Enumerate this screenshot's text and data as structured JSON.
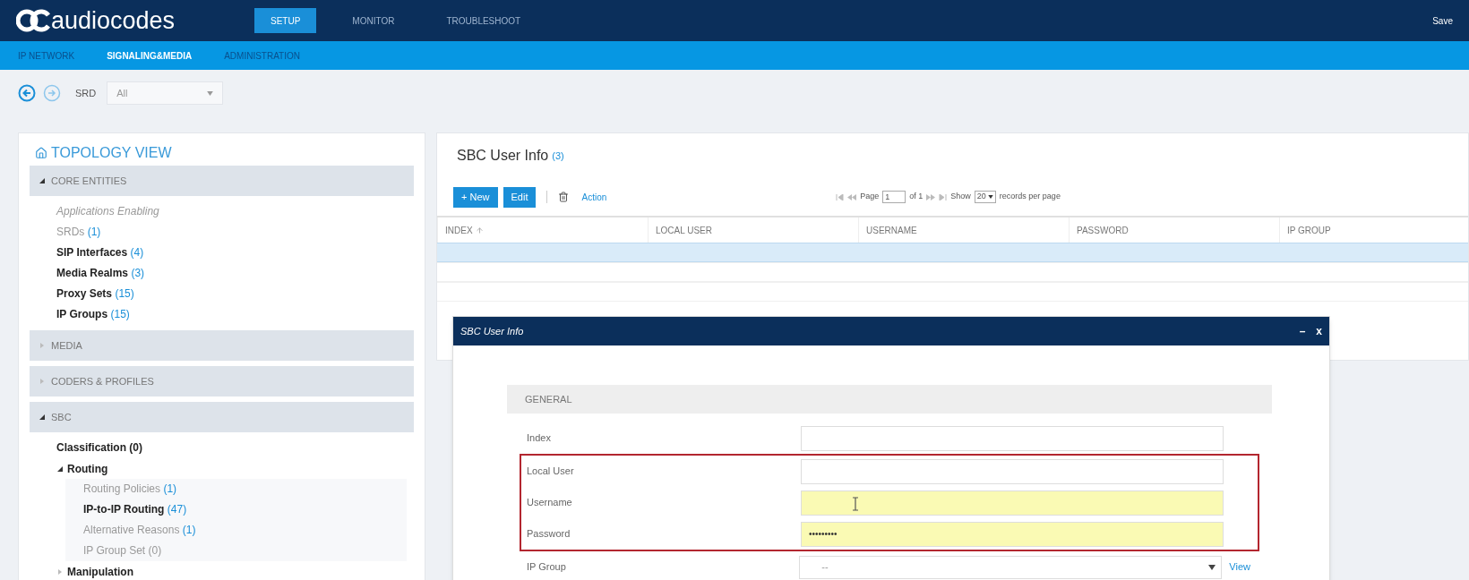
{
  "header": {
    "logo": "audiocodes",
    "tabs": [
      {
        "label": "SETUP",
        "selected": true
      },
      {
        "label": "MONITOR",
        "selected": false
      },
      {
        "label": "TROUBLESHOOT",
        "selected": false
      }
    ],
    "save": "Save"
  },
  "subnav": [
    {
      "label": "IP NETWORK",
      "selected": false
    },
    {
      "label": "SIGNALING&MEDIA",
      "selected": true
    },
    {
      "label": "ADMINISTRATION",
      "selected": false
    }
  ],
  "toolbar": {
    "srd_label": "SRD",
    "srd_value": "All"
  },
  "sidebar": {
    "title": "TOPOLOGY VIEW",
    "sections": [
      {
        "label": "CORE ENTITIES",
        "expanded": true,
        "items": [
          {
            "kind": "note",
            "label": "Applications Enabling",
            "dimmed": true
          },
          {
            "kind": "entry",
            "label": "SRDs",
            "count": "(1)",
            "dimmed": true
          },
          {
            "kind": "entry",
            "label": "SIP Interfaces",
            "count": "(4)",
            "dimmed": false
          },
          {
            "kind": "entry",
            "label": "Media Realms",
            "count": "(3)",
            "dimmed": false
          },
          {
            "kind": "entry",
            "label": "Proxy Sets",
            "count": "(15)",
            "dimmed": false
          },
          {
            "kind": "entry",
            "label": "IP Groups",
            "count": "(15)",
            "dimmed": false
          }
        ]
      },
      {
        "label": "MEDIA",
        "expanded": false
      },
      {
        "label": "CODERS & PROFILES",
        "expanded": false
      },
      {
        "label": "SBC",
        "expanded": true,
        "items": [
          {
            "kind": "entry",
            "label": "Classification (0)",
            "dimmed": false
          },
          {
            "kind": "folder",
            "label": "Routing",
            "expanded": true,
            "children": [
              {
                "kind": "entry",
                "label": "Routing Policies",
                "count": "(1)",
                "dimmed": true
              },
              {
                "kind": "entry",
                "label": "IP-to-IP Routing",
                "count": "(47)",
                "dimmed": false
              },
              {
                "kind": "entry",
                "label": "Alternative Reasons",
                "count": "(1)",
                "dimmed": true
              },
              {
                "kind": "entry",
                "label": "IP Group Set (0)",
                "dimmed": true
              }
            ]
          },
          {
            "kind": "folder",
            "label": "Manipulation",
            "expanded": false
          }
        ]
      }
    ]
  },
  "main": {
    "title": "SBC User Info",
    "count": "(3)",
    "buttons": [
      "+ New",
      "Edit"
    ],
    "action": "Action",
    "pager": {
      "page_label": "Page",
      "page_value": "1",
      "of": "of 1",
      "show": "Show",
      "per_page": "20",
      "suffix": "records per page"
    },
    "table": {
      "columns": [
        "INDEX",
        "LOCAL USER",
        "USERNAME",
        "PASSWORD",
        "IP GROUP"
      ],
      "rows": [
        {
          "selected": true
        },
        {
          "selected": false
        },
        {
          "selected": false
        }
      ]
    }
  },
  "dialog": {
    "title": "SBC User Info",
    "minimize": "–",
    "close": "x",
    "section": "GENERAL",
    "fields": [
      {
        "kind": "text",
        "label": "Index",
        "outlined": false,
        "highlighted": false
      },
      {
        "kind": "text",
        "label": "Local User",
        "outlined": true,
        "highlighted": false
      },
      {
        "kind": "text",
        "label": "Username",
        "outlined": true,
        "highlighted": true
      },
      {
        "kind": "password",
        "label": "Password",
        "value": "•••••••••",
        "outlined": true,
        "highlighted": true
      },
      {
        "kind": "select",
        "label": "IP Group",
        "value": "--",
        "link": "View",
        "outlined": false,
        "highlighted": false
      }
    ]
  }
}
